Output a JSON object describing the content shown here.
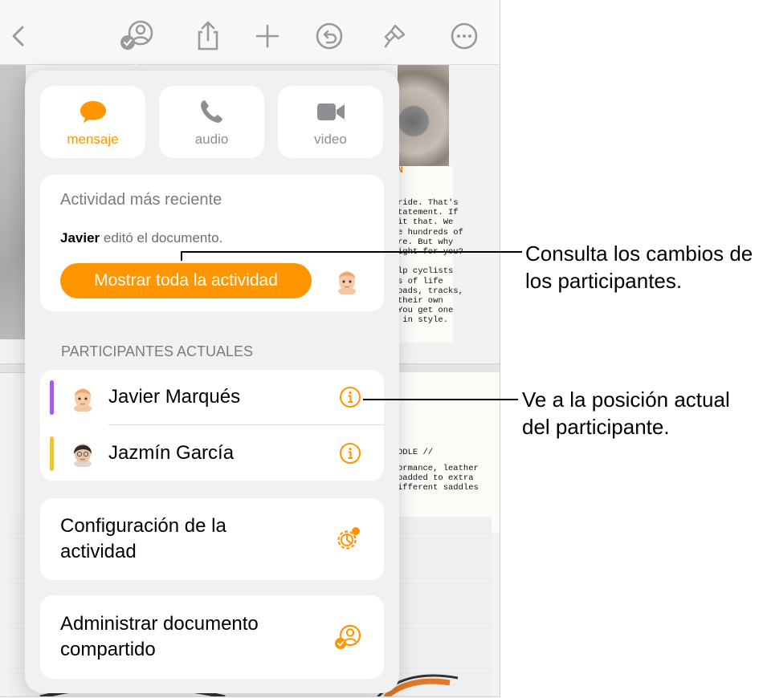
{
  "colors": {
    "accent": "#ff9500",
    "javier_bar": "#a45ee0",
    "jazmin_bar": "#e8c53a",
    "muted": "#8e8e93"
  },
  "toolbar": {
    "icons": [
      "chevron-left-icon",
      "collaboration-icon",
      "share-icon",
      "plus-icon",
      "undo-icon",
      "paintbrush-icon",
      "more-icon"
    ]
  },
  "background_doc": {
    "page1_lines": [
      "ride. That's",
      "tatement. If",
      "it that. We",
      "e hundreds of",
      "re. But why",
      "ight for you?",
      "",
      "lp cyclists",
      "s of life",
      "oads, tracks,",
      "their own",
      "You get one",
      " in style."
    ],
    "page1_heading": "N",
    "page2_heading": "DDLE //",
    "page2_lines": [
      "ormance, leather",
      "padded to extra",
      "ifferent saddles"
    ]
  },
  "popover": {
    "comm_buttons": [
      {
        "label": "mensaje",
        "icon": "message-bubble-icon",
        "color": "#ff9500"
      },
      {
        "label": "audio",
        "icon": "phone-icon",
        "color": "#8e8e93"
      },
      {
        "label": "video",
        "icon": "video-camera-icon",
        "color": "#8e8e93"
      }
    ],
    "activity": {
      "title": "Actividad más reciente",
      "actor": "Javier",
      "action": "editó el documento.",
      "button": "Mostrar toda la actividad"
    },
    "participants_header": "PARTICIPANTES ACTUALES",
    "participants": [
      {
        "name": "Javier Marqués"
      },
      {
        "name": "Jazmín García"
      }
    ],
    "settings_label": "Configuración de la actividad",
    "manage_label": "Administrar documento compartido"
  },
  "callouts": {
    "top": "Consulta los cambios de los participantes.",
    "bottom": "Ve a la posición actual del participante."
  }
}
